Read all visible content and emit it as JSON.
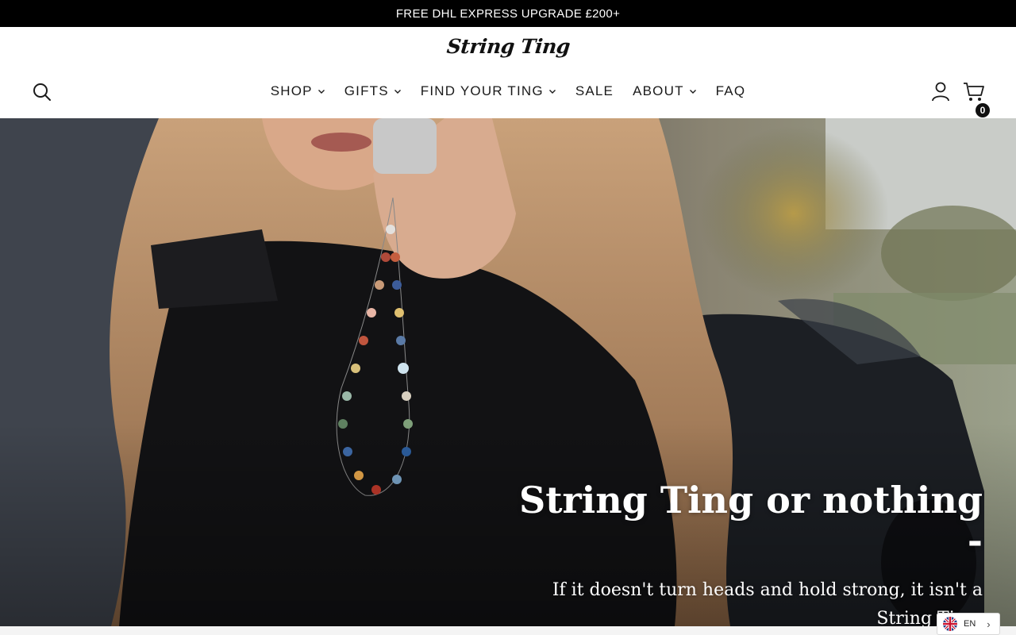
{
  "announcement": {
    "text": "FREE DHL EXPRESS UPGRADE £200+"
  },
  "header": {
    "logo_text": "String Ting",
    "nav": [
      {
        "label": "SHOP",
        "has_dropdown": true
      },
      {
        "label": "GIFTS",
        "has_dropdown": true
      },
      {
        "label": "FIND YOUR TING",
        "has_dropdown": true
      },
      {
        "label": "SALE",
        "has_dropdown": false
      },
      {
        "label": "ABOUT",
        "has_dropdown": true
      },
      {
        "label": "FAQ",
        "has_dropdown": false
      }
    ],
    "icons": {
      "search": "search-icon",
      "account": "user-icon",
      "cart": "shopping-cart-icon"
    },
    "cart_count": "0"
  },
  "hero": {
    "title": "String Ting or nothing -",
    "subtitle": "If it doesn't turn heads and hold strong, it isn't a String Ting.",
    "image_alt": "woman on phone holding beaded phone strap"
  },
  "language": {
    "code": "EN",
    "flag": "uk-flag-icon"
  },
  "colors": {
    "announcement_bg": "#000000",
    "text": "#1a1a1a",
    "hero_text": "#ffffff"
  }
}
